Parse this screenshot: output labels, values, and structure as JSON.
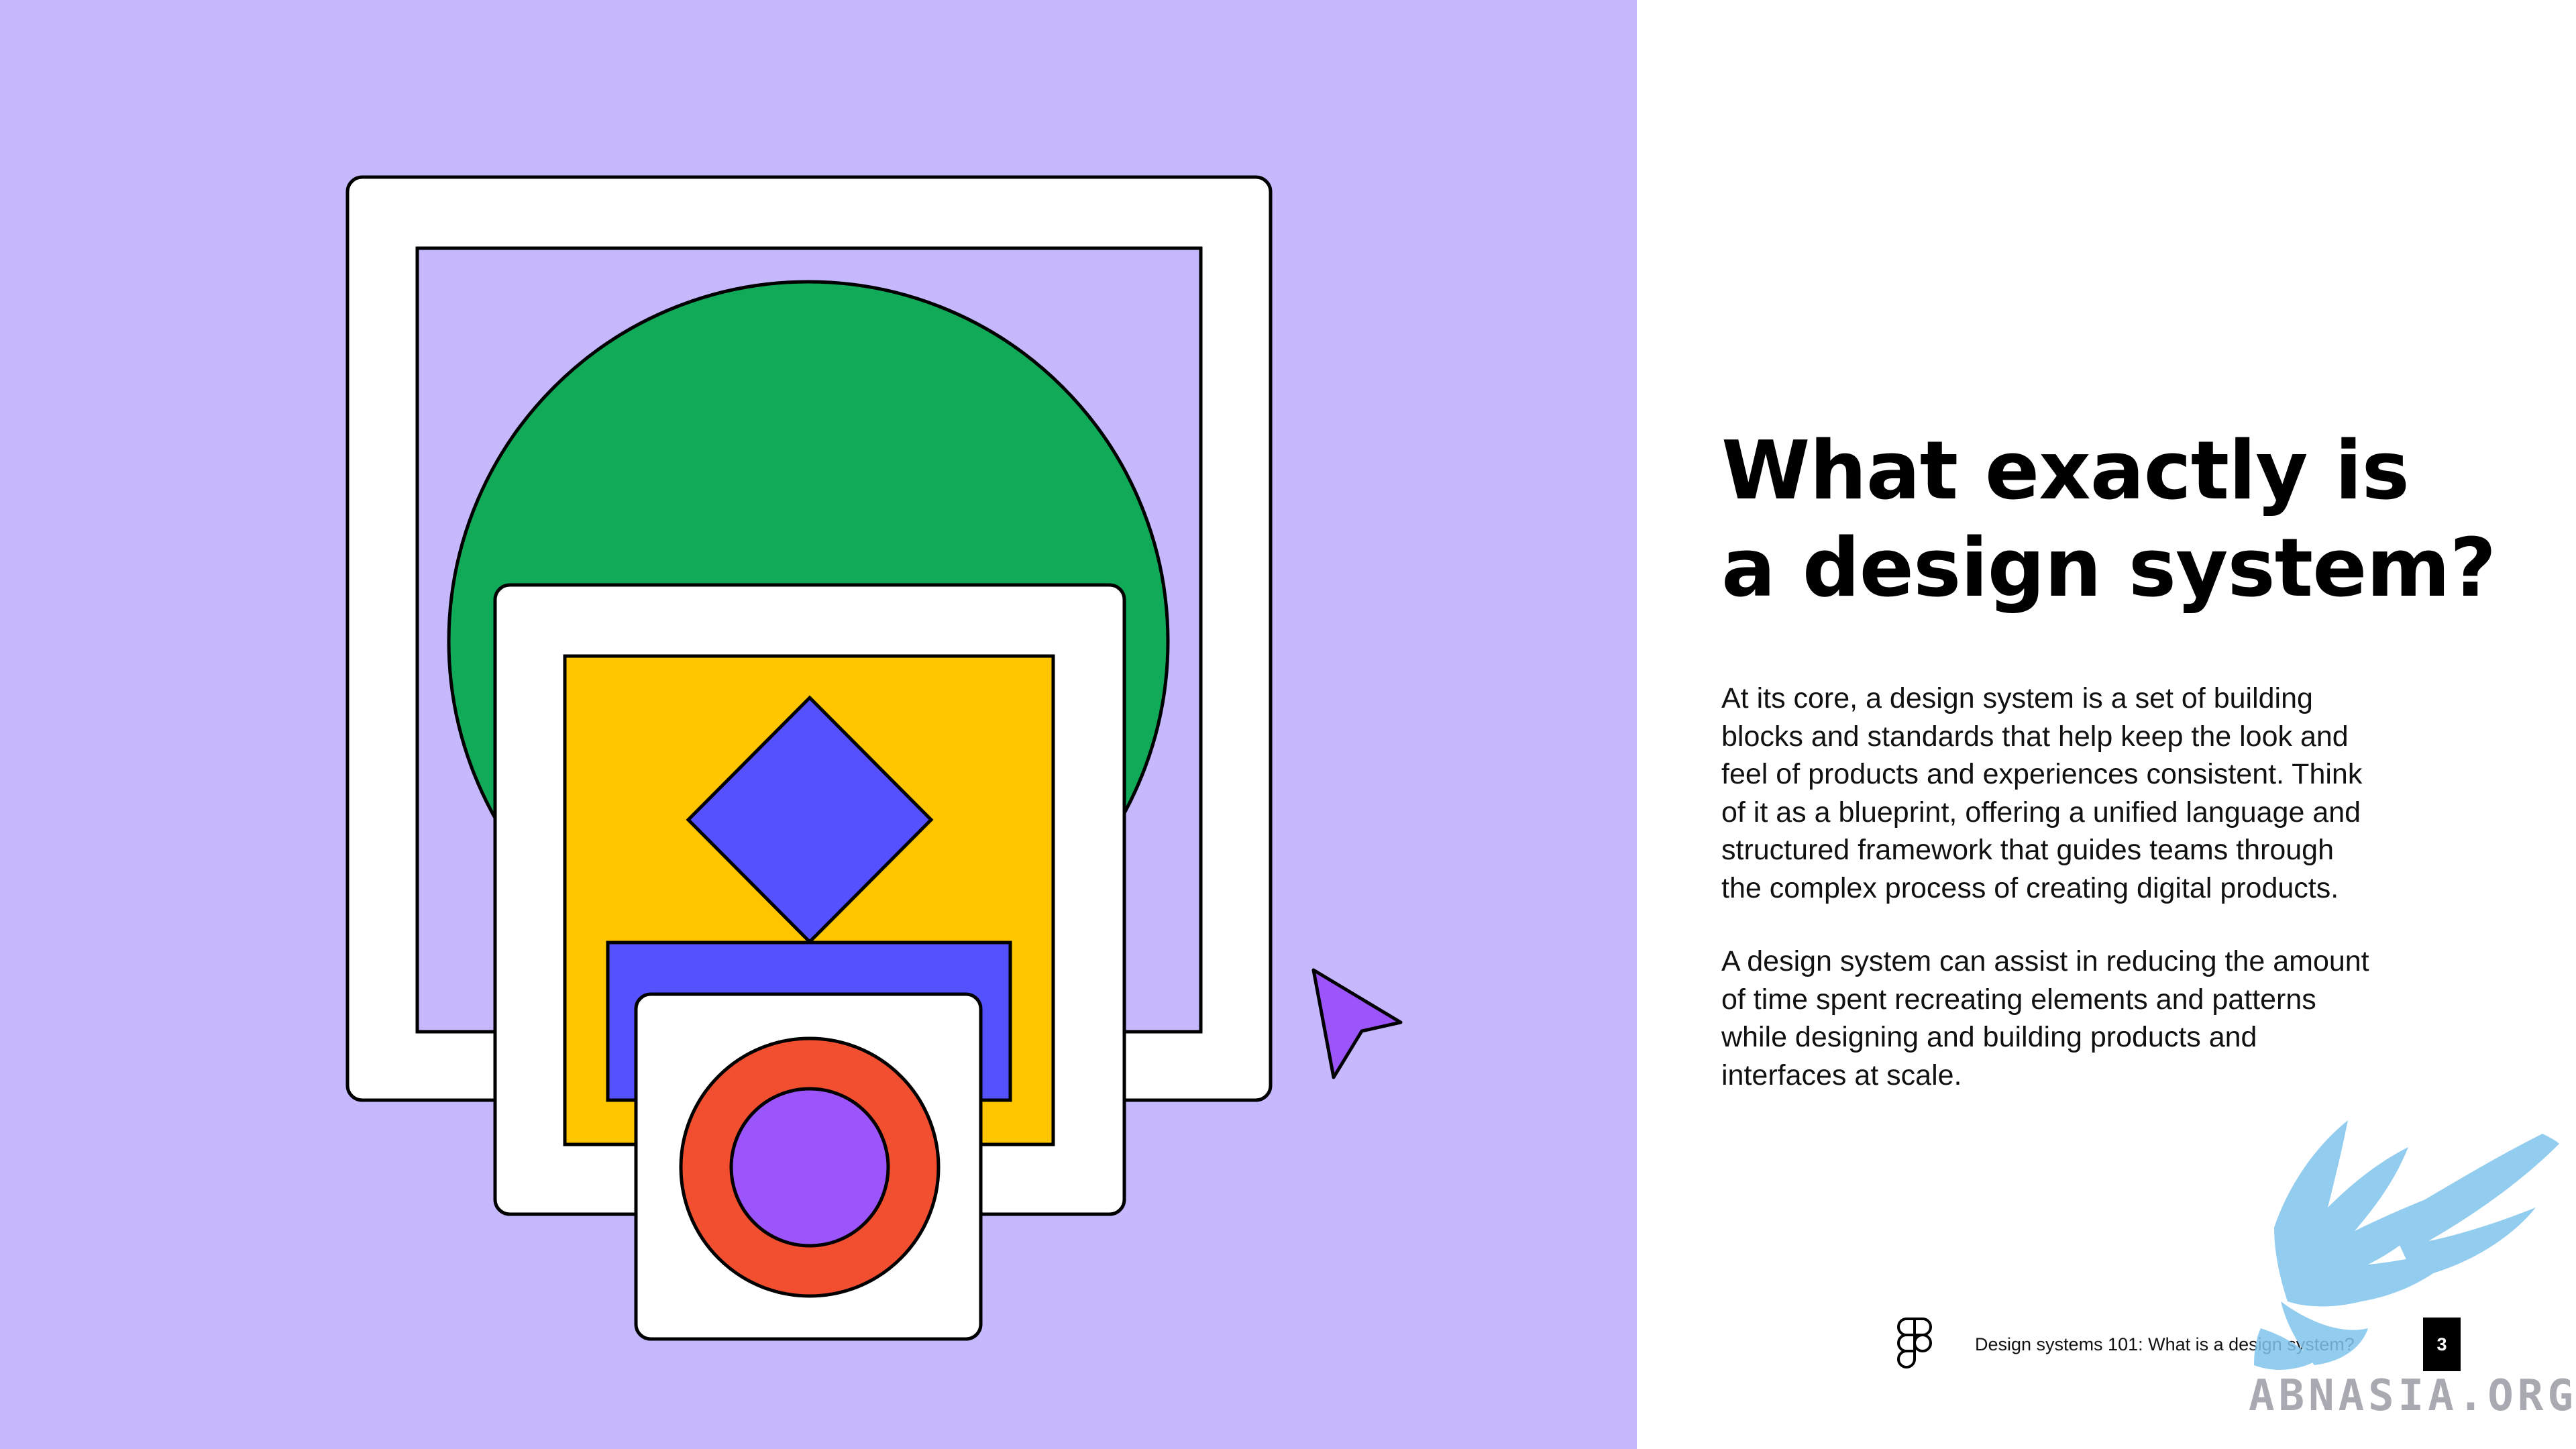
{
  "title": {
    "lines": [
      "What exactly is",
      "a design system?"
    ]
  },
  "body": {
    "paragraph_1": [
      "At its core, a design system is a set of building",
      "blocks and standards that help keep the look and",
      "feel of products and experiences consistent. Think",
      "of it as a blueprint, offering a unified language and",
      "structured framework that guides teams through",
      "the complex process of creating digital products."
    ],
    "paragraph_2": [
      "A design system can assist in reducing the amount",
      "of time spent recreating elements and patterns",
      "while designing and building products and",
      "interfaces at scale."
    ]
  },
  "footer": {
    "logo_icon": "figma-logo-icon",
    "caption": "Design systems 101: What is a design system?",
    "page_number": "3"
  },
  "watermark": {
    "icon": "eagle-watermark-icon",
    "text": "ABNASIA.ORG"
  },
  "illustration": {
    "icons": [
      "nested-frames-illustration",
      "cursor-arrow-icon"
    ],
    "colors": {
      "background": "#c5b8fd",
      "frame": "#ffffff",
      "outline": "#000000",
      "green": "#11aa58",
      "yellow": "#ffc600",
      "blue": "#5551ff",
      "red": "#f24e30",
      "purple": "#9b55fb"
    }
  }
}
